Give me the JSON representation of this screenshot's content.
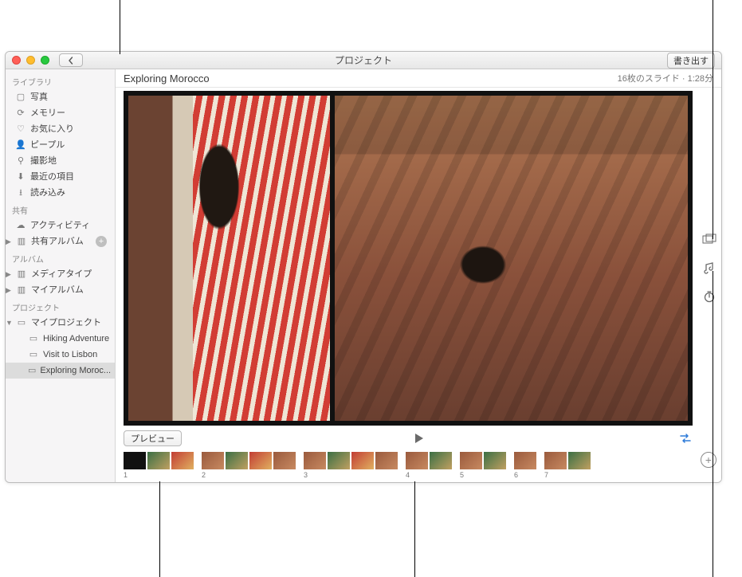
{
  "window": {
    "title": "プロジェクト",
    "export_label": "書き出す"
  },
  "sidebar": {
    "sections": {
      "library": {
        "header": "ライブラリ"
      },
      "shared": {
        "header": "共有"
      },
      "albums": {
        "header": "アルバム"
      },
      "projects": {
        "header": "プロジェクト"
      }
    },
    "library_items": [
      {
        "icon": "photos",
        "label": "写真"
      },
      {
        "icon": "memories",
        "label": "メモリー"
      },
      {
        "icon": "heart",
        "label": "お気に入り"
      },
      {
        "icon": "people",
        "label": "ピープル"
      },
      {
        "icon": "places",
        "label": "撮影地"
      },
      {
        "icon": "recent",
        "label": "最近の項目"
      },
      {
        "icon": "import",
        "label": "読み込み"
      }
    ],
    "shared_items": [
      {
        "icon": "cloud",
        "label": "アクティビティ"
      },
      {
        "icon": "shared",
        "label": "共有アルバム",
        "disclosure": true,
        "add": true
      }
    ],
    "album_items": [
      {
        "icon": "album",
        "label": "メディアタイプ",
        "disclosure": true
      },
      {
        "icon": "album",
        "label": "マイアルバム",
        "disclosure": true
      }
    ],
    "project_root": {
      "label": "マイプロジェクト",
      "disclosure_open": true
    },
    "project_items": [
      {
        "label": "Hiking Adventure"
      },
      {
        "label": "Visit to Lisbon"
      },
      {
        "label": "Exploring Moroc...",
        "selected": true
      }
    ]
  },
  "main": {
    "title": "Exploring Morocco",
    "status": "16枚のスライド · 1:28分",
    "preview_label": "プレビュー"
  },
  "thumbs": {
    "groups": [
      {
        "n": "1",
        "count": 3,
        "first_dark": true
      },
      {
        "n": "2",
        "count": 4
      },
      {
        "n": "3",
        "count": 4
      },
      {
        "n": "4",
        "count": 2
      },
      {
        "n": "5",
        "count": 2
      },
      {
        "n": "6",
        "count": 1
      },
      {
        "n": "7",
        "count": 2
      }
    ]
  },
  "right_toolbar": {
    "theme_icon": "theme-icon",
    "music_icon": "music-icon",
    "timer_icon": "timer-icon"
  }
}
